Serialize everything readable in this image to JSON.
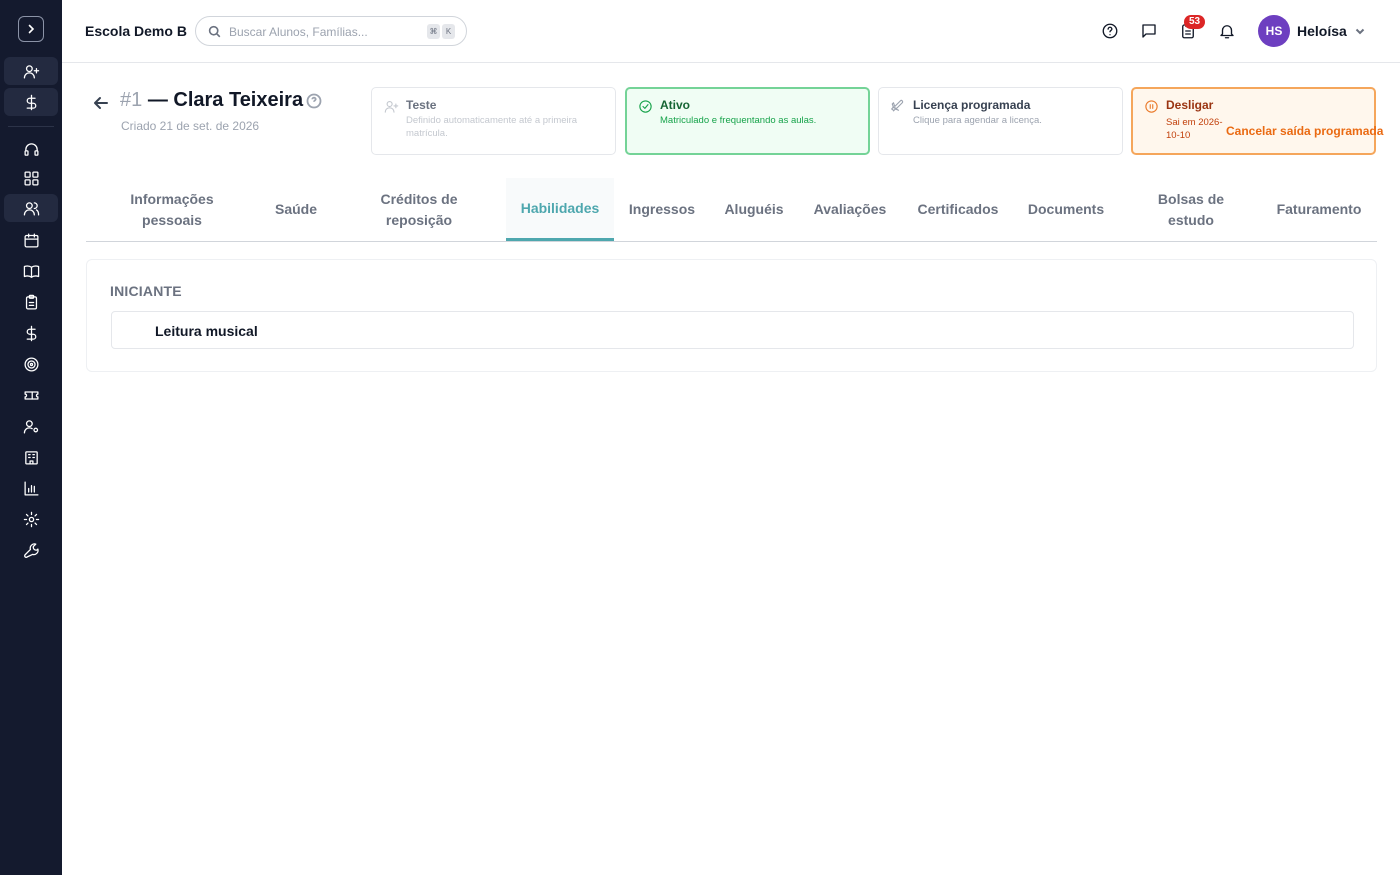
{
  "school_name": "Escola Demo B",
  "search": {
    "placeholder": "Buscar Alunos, Famílias...",
    "kbd1": "⌘",
    "kbd2": "K"
  },
  "notifications": {
    "tasks_count": "53"
  },
  "user": {
    "initials": "HS",
    "name": "Heloísa",
    "avatar_color": "#6d3fc0"
  },
  "student": {
    "number": "#1",
    "name": "— Clara Teixeira",
    "created": "Criado 21 de set. de 2026"
  },
  "status_cards": {
    "trial": {
      "title": "Teste",
      "subtitle": "Definido automaticamente até a primeira matrícula."
    },
    "active": {
      "title": "Ativo",
      "subtitle": "Matriculado e frequentando as aulas."
    },
    "leave": {
      "title": "Licença programada",
      "subtitle": "Clique para agendar a licença."
    },
    "exit": {
      "title": "Desligar",
      "subtitle": "Sai em 2026-10-10",
      "action": "Cancelar saída programada"
    }
  },
  "tabs": [
    {
      "label": "Informações pessoais"
    },
    {
      "label": "Saúde"
    },
    {
      "label": "Créditos de reposição"
    },
    {
      "label": "Habilidades",
      "active": true
    },
    {
      "label": "Ingressos"
    },
    {
      "label": "Aluguéis"
    },
    {
      "label": "Avaliações"
    },
    {
      "label": "Certificados"
    },
    {
      "label": "Documents"
    },
    {
      "label": "Bolsas de estudo"
    },
    {
      "label": "Faturamento"
    }
  ],
  "skills": {
    "level": "INICIANTE",
    "items": [
      "Leitura musical"
    ]
  },
  "colors": {
    "accent": "#4ea7ae",
    "sidebar": "#141a2e",
    "active_green": "#16a34a",
    "exit_orange": "#ea6a12"
  }
}
